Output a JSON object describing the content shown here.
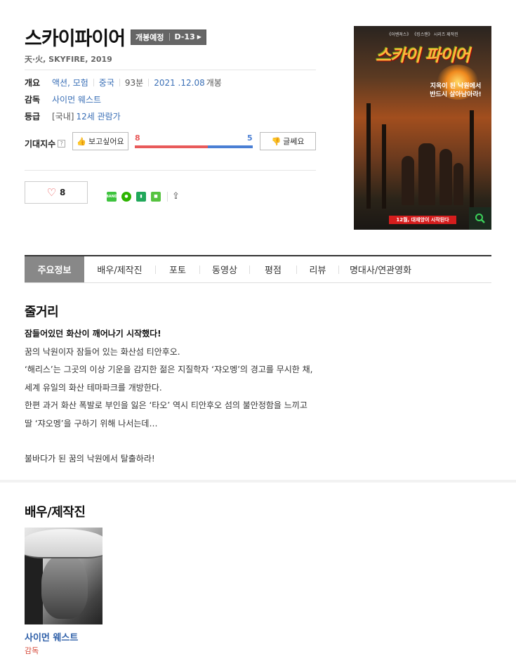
{
  "movie": {
    "title": "스카이파이어",
    "release_status": "개봉예정",
    "dday": "D-13",
    "subtitle": "天·火, SKYFIRE, 2019"
  },
  "info": {
    "overview_label": "개요",
    "genre": "액션, 모험",
    "country": "중국",
    "runtime": "93분",
    "release_date": "2021 .12.08",
    "release_suffix": "개봉",
    "director_label": "감독",
    "director": "사이먼 웨스트",
    "rating_label": "등급",
    "rating_prefix": "[국내]",
    "rating": "12세 관람가"
  },
  "expectation": {
    "label": "기대지수",
    "help_icon": "?",
    "want_label": "보고싶어요",
    "bad_label": "글쎄요",
    "want_count": "8",
    "bad_count": "5",
    "want_ratio": 0.62
  },
  "actions": {
    "like_count": "8",
    "share_band": "BAND"
  },
  "poster": {
    "top_text": "《어벤져스》 《킹스맨》 시리즈 제작진",
    "title": "스카이 파이어",
    "tagline_1": "지옥이 된 낙원에서",
    "tagline_2": "반드시 살아남아라!",
    "release": "12월, 대재앙이 시작된다"
  },
  "tabs": [
    "주요정보",
    "배우/제작진",
    "포토",
    "동영상",
    "평점",
    "리뷰",
    "명대사/연관영화"
  ],
  "synopsis": {
    "title": "줄거리",
    "lead": "잠들어있던 화산이 깨어나기 시작했다!",
    "lines": [
      "꿈의 낙원이자 잠들어 있는 화산섬 티안후오.",
      "‘해리스’는 그곳의 이상 기운을 감지한 젊은 지질학자 ‘쟈오멩’의 경고를 무시한 채,",
      "세계 유일의 화산 테마파크를 개방한다.",
      "한편 과거 화산 폭발로 부인을 잃은 ‘타오’ 역시 티안후오 섬의 불안정함을 느끼고",
      "딸 ‘쟈오멩’을 구하기 위해 나서는데…"
    ],
    "closing": "불바다가 된 꿈의 낙원에서 탈출하라!"
  },
  "cast": {
    "title": "배우/제작진",
    "members": [
      {
        "name": "사이먼 웨스트",
        "role": "감독"
      }
    ]
  }
}
